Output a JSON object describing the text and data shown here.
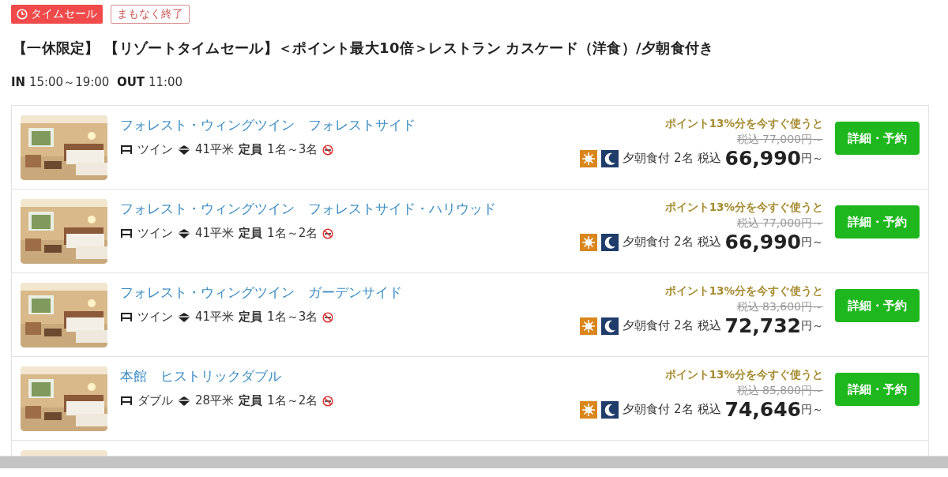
{
  "badges": [
    {
      "kind": "sale",
      "label": "タイムセール"
    },
    {
      "kind": "outline",
      "label": "まもなく終了"
    }
  ],
  "plan_title": "【一休限定】 【リゾートタイムセール】＜ポイント最大10倍＞レストラン カスケード（洋食）/夕朝食付き",
  "checkin": {
    "in_label": "IN",
    "in_time": "15:00～19:00",
    "out_label": "OUT",
    "out_time": "11:00"
  },
  "rooms": [
    {
      "name": "フォレスト・ウィングツイン　フォレストサイド",
      "bed": "ツイン",
      "area": "41平米",
      "capacity_label": "定員",
      "capacity": "1名～3名",
      "non_smoking": true,
      "points_note": "ポイント13%分を今すぐ使うと",
      "original_price": "税込 77,000円～",
      "meal": "夕朝食付 2名",
      "tax_label": "税込",
      "price": "66,990",
      "price_suffix": "円～",
      "button": "詳細・予約"
    },
    {
      "name": "フォレスト・ウィングツイン　フォレストサイド・ハリウッド",
      "bed": "ツイン",
      "area": "41平米",
      "capacity_label": "定員",
      "capacity": "1名～2名",
      "non_smoking": true,
      "points_note": "ポイント13%分を今すぐ使うと",
      "original_price": "税込 77,000円～",
      "meal": "夕朝食付 2名",
      "tax_label": "税込",
      "price": "66,990",
      "price_suffix": "円～",
      "button": "詳細・予約"
    },
    {
      "name": "フォレスト・ウィングツイン　ガーデンサイド",
      "bed": "ツイン",
      "area": "41平米",
      "capacity_label": "定員",
      "capacity": "1名～3名",
      "non_smoking": true,
      "points_note": "ポイント13%分を今すぐ使うと",
      "original_price": "税込 83,600円～",
      "meal": "夕朝食付 2名",
      "tax_label": "税込",
      "price": "72,732",
      "price_suffix": "円～",
      "button": "詳細・予約"
    },
    {
      "name": "本館　ヒストリックダブル",
      "bed": "ダブル",
      "area": "28平米",
      "capacity_label": "定員",
      "capacity": "1名～2名",
      "non_smoking": true,
      "points_note": "ポイント13%分を今すぐ使うと",
      "original_price": "税込 85,800円～",
      "meal": "夕朝食付 2名",
      "tax_label": "税込",
      "price": "74,646",
      "price_suffix": "円～",
      "button": "詳細・予約"
    }
  ]
}
